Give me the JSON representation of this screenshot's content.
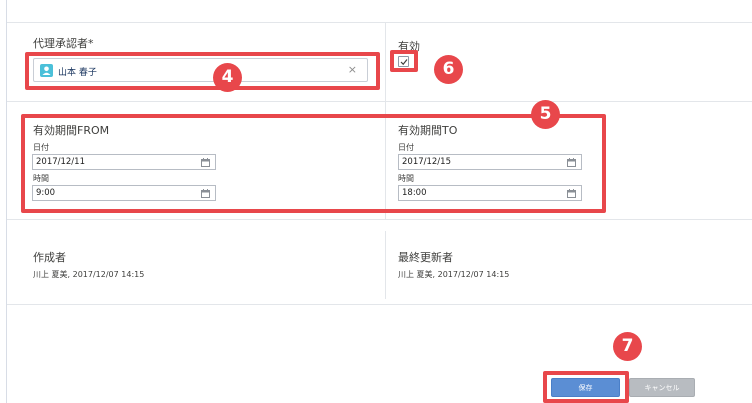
{
  "fields": {
    "delegate": {
      "label": "代理承認者*",
      "value": "山本 春子",
      "clear_icon": "×"
    },
    "active": {
      "label": "有効",
      "checked": true
    },
    "valid_from": {
      "label": "有効期間FROM",
      "date_label": "日付",
      "date_value": "2017/12/11",
      "time_label": "時間",
      "time_value": "9:00"
    },
    "valid_to": {
      "label": "有効期間TO",
      "date_label": "日付",
      "date_value": "2017/12/15",
      "time_label": "時間",
      "time_value": "18:00"
    },
    "created_by": {
      "label": "作成者",
      "value": "川上 夏美, 2017/12/07 14:15"
    },
    "last_modified_by": {
      "label": "最終更新者",
      "value": "川上 夏美, 2017/12/07 14:15"
    }
  },
  "buttons": {
    "save": "保存",
    "cancel": "キャンセル"
  },
  "callouts": {
    "c4": "4",
    "c5": "5",
    "c6": "6",
    "c7": "7"
  },
  "colors": {
    "callout_red": "#e8474b",
    "save_blue": "#5b8ed4",
    "cancel_gray": "#b8bcc1",
    "avatar_teal": "#4bc0d9"
  },
  "icons": {
    "avatar": "user-avatar-icon",
    "clear": "close-icon",
    "checkbox": "checkmark-icon",
    "calendar": "calendar-icon"
  }
}
